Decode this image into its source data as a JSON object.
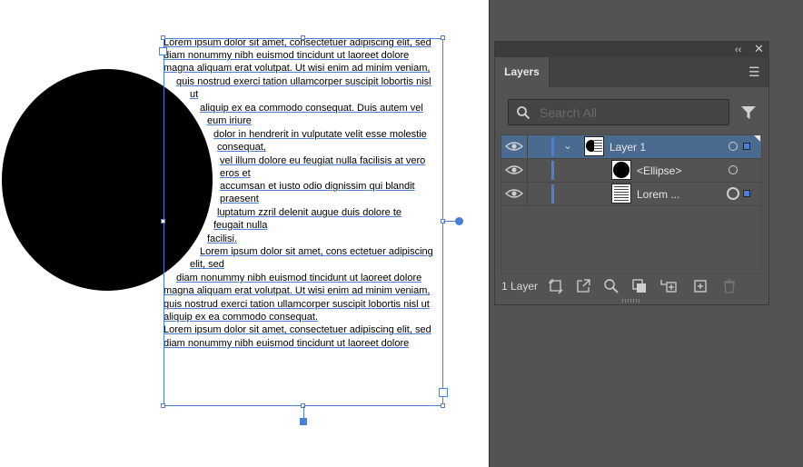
{
  "canvas": {
    "text_lines": [
      "Lorem ipsum dolor sit amet, consectetuer adipiscing elit, sed",
      "diam nonummy nibh euismod tincidunt ut laoreet dolore",
      "magna aliquam erat volutpat. Ut wisi enim ad minim veniam,",
      "quis nostrud exerci tation ullamcorper suscipit lobortis nisl",
      "ut",
      "aliquip ex ea commodo consequat. Duis autem vel",
      "eum iriure",
      "dolor in hendrerit in vulputate velit esse molestie",
      "consequat,",
      "vel illum dolore eu feugiat nulla facilisis at vero",
      "eros et",
      "accumsan et iusto odio dignissim qui blandit",
      "praesent",
      "luptatum zzril delenit augue duis dolore te",
      "feugait nulla",
      "facilisi.",
      "Lorem ipsum dolor sit amet, cons ectetuer adipiscing",
      "elit, sed",
      "diam nonummy nibh euismod tincidunt ut laoreet dolore",
      "magna aliquam erat volutpat. Ut wisi enim ad minim veniam,",
      "quis nostrud exerci tation ullamcorper suscipit lobortis nisl ut",
      "aliquip ex ea commodo consequat.",
      "Lorem ipsum dolor sit amet, consectetuer adipiscing elit, sed",
      "diam nonummy nibh euismod tincidunt ut laoreet dolore"
    ]
  },
  "panel": {
    "tab_label": "Layers",
    "search_placeholder": "Search All",
    "layers": [
      {
        "label": "Layer 1"
      },
      {
        "label": "<Ellipse>"
      },
      {
        "label": "Lorem ..."
      }
    ],
    "footer_count": "1 Layer"
  },
  "colors": {
    "accent": "#4a7fd8",
    "panel_bg": "#535353",
    "selected_row": "#4a6a8f"
  }
}
